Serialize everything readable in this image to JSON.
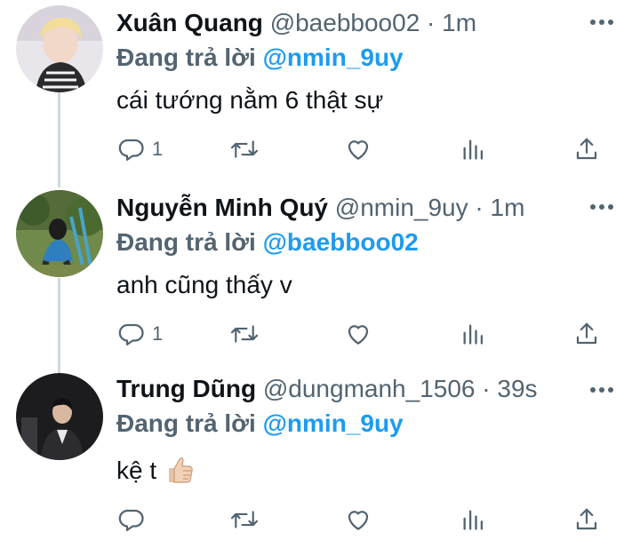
{
  "tweets": [
    {
      "name": "Xuân Quang",
      "handle": "@baebboo02",
      "separator": "·",
      "time": "1m",
      "replying_prefix": "Đang trả lời",
      "replying_to": "@nmin_9uy",
      "text": "cái tướng nằm 6 thật sự",
      "reply_count": "1",
      "emoji": ""
    },
    {
      "name": "Nguyễn Minh Quý",
      "handle": "@nmin_9uy",
      "separator": "·",
      "time": "1m",
      "replying_prefix": "Đang trả lời",
      "replying_to": "@baebboo02",
      "text": "anh cũng thấy v",
      "reply_count": "1",
      "emoji": ""
    },
    {
      "name": "Trung Dũng",
      "handle": "@dungmanh_1506",
      "separator": "·",
      "time": "39s",
      "replying_prefix": "Đang trả lời",
      "replying_to": "@nmin_9uy",
      "text": "kệ t",
      "reply_count": "",
      "emoji": "thumbs-up"
    }
  ],
  "colors": {
    "accent": "#1d9bf0",
    "secondary_text": "#536471",
    "primary_text": "#0f1419",
    "thread_line": "#cfd9de"
  },
  "icons": [
    "reply-icon",
    "retweet-icon",
    "like-icon",
    "analytics-icon",
    "share-icon",
    "more-icon"
  ]
}
